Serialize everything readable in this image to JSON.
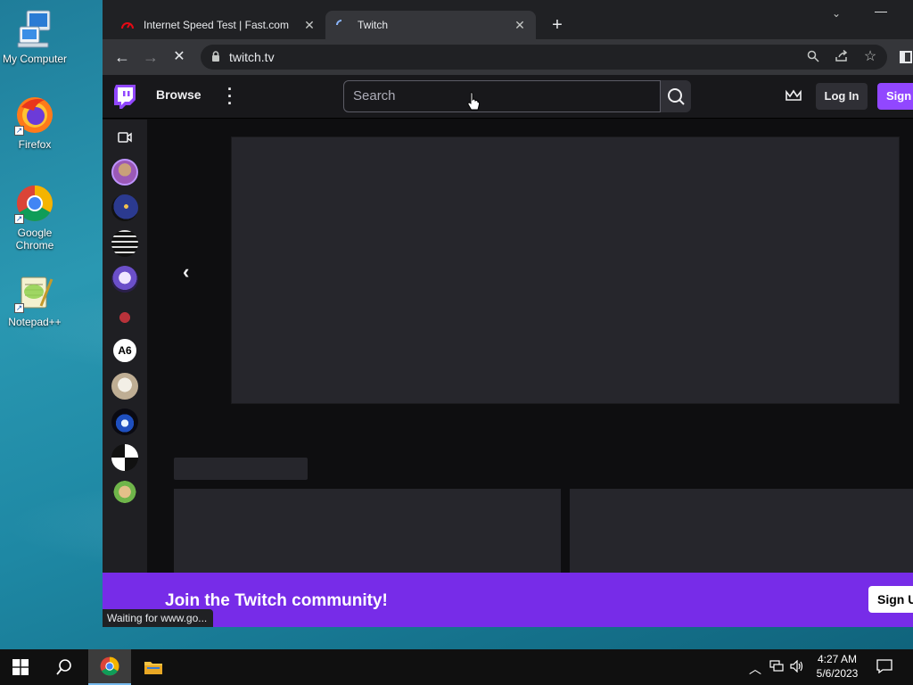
{
  "desktop": {
    "icons": [
      {
        "label": "My Computer",
        "icon": "computer-icon"
      },
      {
        "label": "Firefox",
        "icon": "firefox-icon"
      },
      {
        "label": "Google Chrome",
        "icon": "chrome-icon"
      },
      {
        "label": "Notepad++",
        "icon": "notepadpp-icon"
      }
    ]
  },
  "browser": {
    "tabs": [
      {
        "title": "Internet Speed Test | Fast.com",
        "active": false,
        "icon": "fast-com-icon"
      },
      {
        "title": "Twitch",
        "active": true,
        "icon": "loading-spinner-icon"
      }
    ],
    "new_tab": "+",
    "url": "twitch.tv",
    "status_text": "Waiting for www.go..."
  },
  "twitch": {
    "nav": {
      "browse": "Browse",
      "search_placeholder": "Search",
      "login": "Log In",
      "signup": "Sign"
    },
    "banner": {
      "text": "Join the Twitch community!",
      "signup": "Sign U"
    }
  },
  "taskbar": {
    "time": "4:27 AM",
    "date": "5/6/2023"
  }
}
